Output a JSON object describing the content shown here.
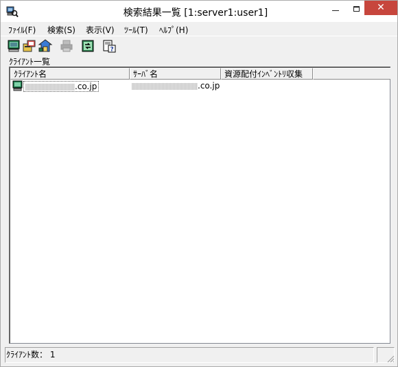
{
  "window": {
    "title": "検索結果一覧 [1:server1:user1]",
    "close_glyph": "✕"
  },
  "menu": [
    {
      "label": "ﾌｧｲﾙ(F)"
    },
    {
      "label": "検索(S)"
    },
    {
      "label": "表示(V)"
    },
    {
      "label": "ﾂｰﾙ(T)"
    },
    {
      "label": "ﾍﾙﾌﾟ(H)"
    }
  ],
  "toolbar": {
    "buttons": [
      {
        "icon": "client-list-icon",
        "enabled": true
      },
      {
        "icon": "inventory-icon",
        "enabled": true
      },
      {
        "icon": "distribution-icon",
        "enabled": true
      },
      {
        "icon": "print-icon",
        "enabled": false
      },
      {
        "icon": "refresh-icon",
        "enabled": true
      },
      {
        "icon": "help-icon",
        "enabled": true
      }
    ]
  },
  "section_label": "ｸﾗｲｱﾝﾄ一覧",
  "list": {
    "columns": [
      {
        "label": "ｸﾗｲｱﾝﾄ名"
      },
      {
        "label": "ｻｰﾊﾞ名"
      },
      {
        "label": "資源配付ｲﾝﾍﾞﾝﾄﾘ収集"
      }
    ],
    "rows": [
      {
        "client_suffix": ".co.jp",
        "server_suffix": ".co.jp",
        "inventory": ""
      }
    ]
  },
  "status": {
    "text": "ｸﾗｲｱﾝﾄ数：  1"
  }
}
